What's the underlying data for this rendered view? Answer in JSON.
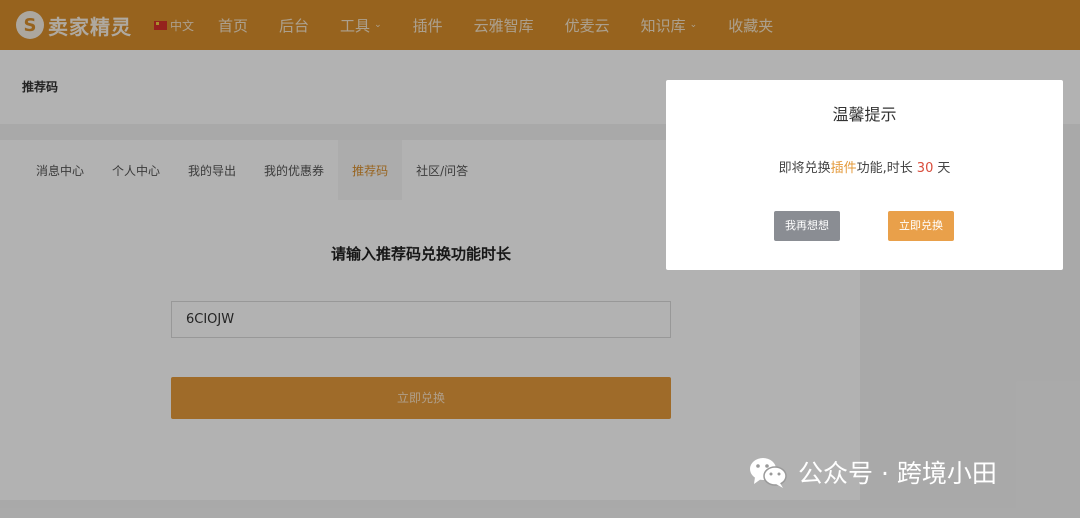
{
  "navbar": {
    "logo_glyph": "S",
    "logo_text": "卖家精灵",
    "language": "中文",
    "items": [
      {
        "label": "首页",
        "dropdown": false
      },
      {
        "label": "后台",
        "dropdown": false
      },
      {
        "label": "工具",
        "dropdown": true
      },
      {
        "label": "插件",
        "dropdown": false
      },
      {
        "label": "云雅智库",
        "dropdown": false
      },
      {
        "label": "优麦云",
        "dropdown": false
      },
      {
        "label": "知识库",
        "dropdown": true
      },
      {
        "label": "收藏夹",
        "dropdown": false
      }
    ]
  },
  "page": {
    "title": "推荐码"
  },
  "tabs": [
    {
      "label": "消息中心"
    },
    {
      "label": "个人中心"
    },
    {
      "label": "我的导出"
    },
    {
      "label": "我的优惠券"
    },
    {
      "label": "推荐码",
      "active": true
    },
    {
      "label": "社区/问答"
    }
  ],
  "form": {
    "title": "请输入推荐码兑换功能时长",
    "code_value": "6CIOJW",
    "submit_label": "立即兑换"
  },
  "modal": {
    "title": "温馨提示",
    "message_prefix": "即将兑换",
    "message_plugin": "插件",
    "message_mid": "功能,时长",
    "message_days": "30",
    "message_suffix": "天",
    "cancel_label": "我再想想",
    "confirm_label": "立即兑换"
  },
  "watermark": {
    "text": "公众号 · 跨境小田"
  },
  "colors": {
    "brand": "#d98f2c",
    "accent": "#e49a3b",
    "days": "#d94d3c"
  }
}
